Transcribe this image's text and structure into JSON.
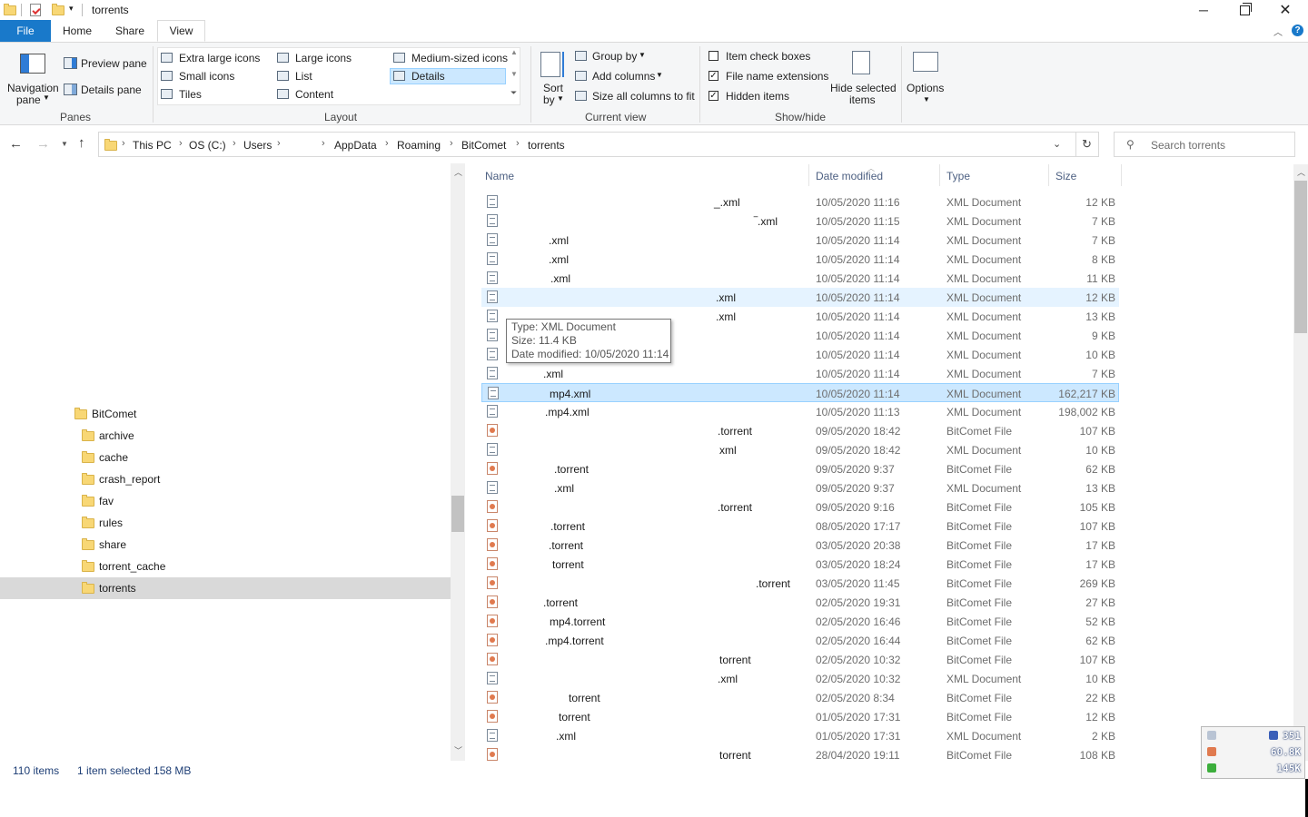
{
  "window": {
    "title": "torrents"
  },
  "ribbon": {
    "tabs": [
      "File",
      "Home",
      "Share",
      "View"
    ],
    "panes": {
      "navigation_pane": "Navigation",
      "navigation_pane_2": "pane",
      "preview_pane": "Preview pane",
      "details_pane": "Details pane",
      "group": "Panes"
    },
    "layout": {
      "items": [
        "Extra large icons",
        "Large icons",
        "Medium-sized icons",
        "Small icons",
        "List",
        "Details",
        "Tiles",
        "Content"
      ],
      "selected": "Details",
      "group": "Layout"
    },
    "current_view": {
      "sort_by": "Sort",
      "sort_by_2": "by",
      "group_by": "Group by",
      "add_columns": "Add columns",
      "size_columns": "Size all columns to fit",
      "group": "Current view"
    },
    "show_hide": {
      "item_check_boxes": "Item check boxes",
      "item_check_boxes_checked": false,
      "file_name_extensions": "File name extensions",
      "file_name_extensions_checked": true,
      "hidden_items": "Hidden items",
      "hidden_items_checked": true,
      "hide_selected": "Hide selected",
      "hide_selected_2": "items",
      "group": "Show/hide"
    },
    "options": "Options"
  },
  "address": {
    "crumbs": [
      "This PC",
      "OS (C:)",
      "Users",
      "AppData",
      "Roaming",
      "BitComet",
      "torrents"
    ],
    "search_placeholder": "Search torrents"
  },
  "nav": {
    "items": [
      "BitComet",
      "archive",
      "cache",
      "crash_report",
      "fav",
      "rules",
      "share",
      "torrent_cache",
      "torrents"
    ],
    "selected": "torrents"
  },
  "columns": [
    "Name",
    "Date modified",
    "Type",
    "Size"
  ],
  "rows": [
    {
      "name": "_.xml",
      "date": "10/05/2020 11:16",
      "type": "XML Document",
      "size": "12 KB"
    },
    {
      "name": "‾.xml",
      "date": "10/05/2020 11:15",
      "type": "XML Document",
      "size": "7 KB"
    },
    {
      "name": ".xml",
      "date": "10/05/2020 11:14",
      "type": "XML Document",
      "size": "7 KB"
    },
    {
      "name": ".xml",
      "date": "10/05/2020 11:14",
      "type": "XML Document",
      "size": "8 KB"
    },
    {
      "name": ".xml",
      "date": "10/05/2020 11:14",
      "type": "XML Document",
      "size": "11 KB"
    },
    {
      "name": ".xml",
      "date": "10/05/2020 11:14",
      "type": "XML Document",
      "size": "12 KB"
    },
    {
      "name": ".xml",
      "date": "10/05/2020 11:14",
      "type": "XML Document",
      "size": "13 KB"
    },
    {
      "name": "",
      "date": "10/05/2020 11:14",
      "type": "XML Document",
      "size": "9 KB"
    },
    {
      "name": "",
      "date": "10/05/2020 11:14",
      "type": "XML Document",
      "size": "10 KB"
    },
    {
      "name": ".xml",
      "date": "10/05/2020 11:14",
      "type": "XML Document",
      "size": "7 KB"
    },
    {
      "name": "mp4.xml",
      "date": "10/05/2020 11:14",
      "type": "XML Document",
      "size": "162,217 KB"
    },
    {
      "name": ".mp4.xml",
      "date": "10/05/2020 11:13",
      "type": "XML Document",
      "size": "198,002 KB"
    },
    {
      "name": ".torrent",
      "date": "09/05/2020 18:42",
      "type": "BitComet File",
      "size": "107 KB"
    },
    {
      "name": "xml",
      "date": "09/05/2020 18:42",
      "type": "XML Document",
      "size": "10 KB"
    },
    {
      "name": ".torrent",
      "date": "09/05/2020 9:37",
      "type": "BitComet File",
      "size": "62 KB"
    },
    {
      "name": ".xml",
      "date": "09/05/2020 9:37",
      "type": "XML Document",
      "size": "13 KB"
    },
    {
      "name": ".torrent",
      "date": "09/05/2020 9:16",
      "type": "BitComet File",
      "size": "105 KB"
    },
    {
      "name": ".torrent",
      "date": "08/05/2020 17:17",
      "type": "BitComet File",
      "size": "107 KB"
    },
    {
      "name": ".torrent",
      "date": "03/05/2020 20:38",
      "type": "BitComet File",
      "size": "17 KB"
    },
    {
      "name": "torrent",
      "date": "03/05/2020 18:24",
      "type": "BitComet File",
      "size": "17 KB"
    },
    {
      "name": ".torrent",
      "date": "03/05/2020 11:45",
      "type": "BitComet File",
      "size": "269 KB"
    },
    {
      "name": ".torrent",
      "date": "02/05/2020 19:31",
      "type": "BitComet File",
      "size": "27 KB"
    },
    {
      "name": "mp4.torrent",
      "date": "02/05/2020 16:46",
      "type": "BitComet File",
      "size": "52 KB"
    },
    {
      "name": ".mp4.torrent",
      "date": "02/05/2020 16:44",
      "type": "BitComet File",
      "size": "62 KB"
    },
    {
      "name": "torrent",
      "date": "02/05/2020 10:32",
      "type": "BitComet File",
      "size": "107 KB"
    },
    {
      "name": ".xml",
      "date": "02/05/2020 10:32",
      "type": "XML Document",
      "size": "10 KB"
    },
    {
      "name": "torrent",
      "date": "02/05/2020 8:34",
      "type": "BitComet File",
      "size": "22 KB"
    },
    {
      "name": "torrent",
      "date": "01/05/2020 17:31",
      "type": "BitComet File",
      "size": "12 KB"
    },
    {
      "name": ".xml",
      "date": "01/05/2020 17:31",
      "type": "XML Document",
      "size": "2 KB"
    },
    {
      "name": "torrent",
      "date": "28/04/2020 19:11",
      "type": "BitComet File",
      "size": "108 KB"
    }
  ],
  "tooltip": {
    "type": "Type: XML Document",
    "size": "Size: 11.4 KB",
    "modified": "Date modified: 10/05/2020 11:14"
  },
  "status": {
    "items": "110 items",
    "selected": "1 item selected  158 MB"
  },
  "widget": {
    "v1": "351",
    "v2": "60.8K",
    "v3": "145K"
  },
  "colors": {
    "accent": "#1979ca",
    "selection": "#cce8ff",
    "hover": "#e5f3ff"
  }
}
